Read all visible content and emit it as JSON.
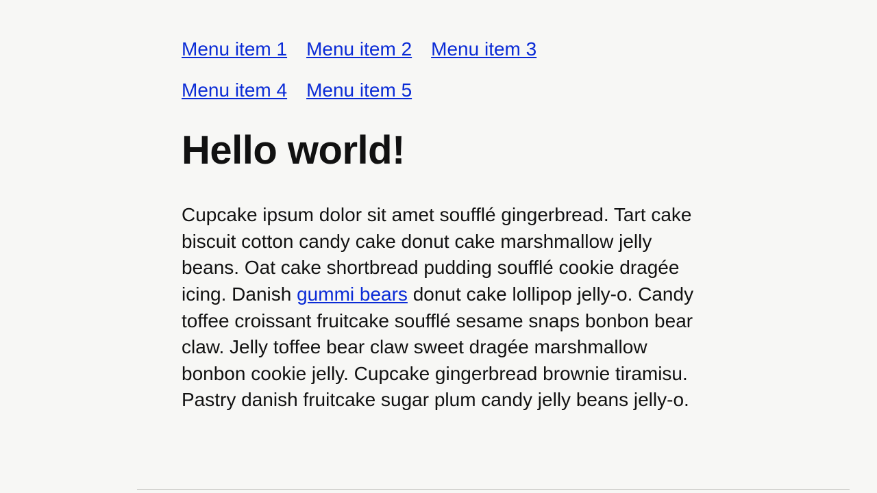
{
  "nav": {
    "items": [
      {
        "label": "Menu item 1"
      },
      {
        "label": "Menu item 2"
      },
      {
        "label": "Menu item 3"
      },
      {
        "label": "Menu item 4"
      },
      {
        "label": "Menu item 5"
      }
    ]
  },
  "main": {
    "heading": "Hello world!",
    "paragraph": {
      "before_link": "Cupcake ipsum dolor sit amet soufflé gingerbread. Tart cake biscuit cotton candy cake donut cake marshmallow jelly beans. Oat cake shortbread pudding soufflé cookie dragée icing. Danish ",
      "link_text": "gummi bears",
      "after_link": " donut cake lollipop jelly-o. Candy toffee croissant fruitcake soufflé sesame snaps bonbon bear claw. Jelly toffee bear claw sweet dragée marshmallow bonbon cookie jelly. Cupcake gingerbread brownie tiramisu. Pastry danish fruitcake sugar plum candy jelly beans jelly-o."
    }
  }
}
